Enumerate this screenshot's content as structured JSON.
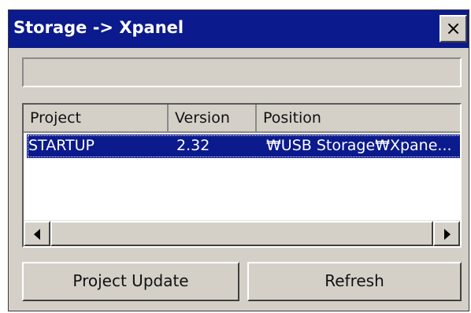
{
  "window": {
    "title": "Storage -> Xpanel",
    "close_glyph": "×"
  },
  "list": {
    "columns": [
      "Project",
      "Version",
      "Position"
    ],
    "rows": [
      {
        "project": "STARTUP",
        "version": "2.32",
        "position": "₩USB Storage₩Xpane..."
      }
    ]
  },
  "buttons": {
    "project_update": "Project Update",
    "refresh": "Refresh"
  },
  "colors": {
    "titlebar": "#0b1a8c",
    "selection": "#0b1a8c",
    "face": "#d4d0c8"
  },
  "icons": {
    "close": "close-icon",
    "scroll_left": "arrow-left-icon",
    "scroll_right": "arrow-right-icon"
  }
}
